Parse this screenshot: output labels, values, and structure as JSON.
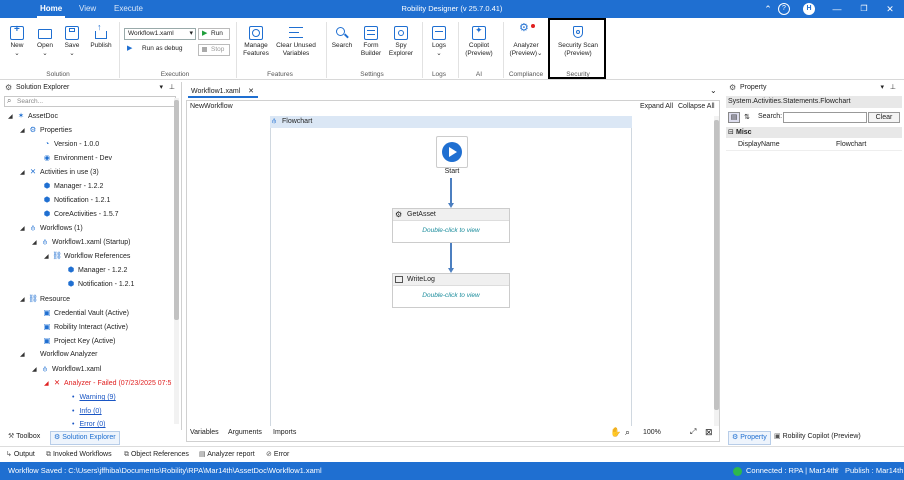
{
  "titlebar": {
    "tabs": [
      "Home",
      "View",
      "Execute"
    ],
    "app_title": "Robility Designer (v 25.7.0.41)",
    "help_label": "?",
    "avatar_initial": "H",
    "accent": "#1f6fd1"
  },
  "ribbon": {
    "new": "New",
    "open": "Open",
    "save": "Save",
    "publish": "Publish",
    "group_solution": "Solution",
    "workflow_select": "Workflow1.xaml",
    "run": "Run",
    "run_debug": "Run as debug",
    "stop": "Stop",
    "group_execution": "Execution",
    "manage_features": [
      "Manage",
      "Features"
    ],
    "clear_unused": [
      "Clear Unused",
      "Variables"
    ],
    "group_features": "Features",
    "search": "Search",
    "form_builder": [
      "Form",
      "Builder"
    ],
    "spy_explorer": [
      "Spy",
      "Explorer"
    ],
    "group_settings": "Settings",
    "logs": "Logs",
    "group_logs": "Logs",
    "copilot": [
      "Copilot",
      "(Preview)"
    ],
    "group_ai": "AI",
    "analyzer": [
      "Analyzer",
      "(Preview)"
    ],
    "group_compliance": "Compliance",
    "security_scan": [
      "Security Scan",
      "(Preview)"
    ],
    "group_security": "Security"
  },
  "solution_explorer": {
    "title": "Solution Explorer",
    "search_placeholder": "Search...",
    "items": [
      {
        "label": "AssetDoc",
        "level": 0
      },
      {
        "label": "Properties",
        "level": 1
      },
      {
        "label": "Version - 1.0.0",
        "level": 2
      },
      {
        "label": "Environment - Dev",
        "level": 2
      },
      {
        "label": "Activities in use (3)",
        "level": 1
      },
      {
        "label": "Manager - 1.2.2",
        "level": 2
      },
      {
        "label": "Notification - 1.2.1",
        "level": 2
      },
      {
        "label": "CoreActivities - 1.5.7",
        "level": 2
      },
      {
        "label": "Workflows (1)",
        "level": 1
      },
      {
        "label": "Workflow1.xaml (Startup)",
        "level": 2
      },
      {
        "label": "Workflow References",
        "level": 3
      },
      {
        "label": "Manager - 1.2.2",
        "level": 4
      },
      {
        "label": "Notification - 1.2.1",
        "level": 4
      },
      {
        "label": "Resource",
        "level": 1
      },
      {
        "label": "Credential Vault (Active)",
        "level": 2
      },
      {
        "label": "Robility Interact (Active)",
        "level": 2
      },
      {
        "label": "Project Key (Active)",
        "level": 2
      },
      {
        "label": "Workflow Analyzer",
        "level": 1
      },
      {
        "label": "Workflow1.xaml",
        "level": 2
      },
      {
        "label": "Analyzer - Failed (07/23/2025 07:5",
        "level": 3
      },
      {
        "label": "Warning (9)",
        "level": 4
      },
      {
        "label": "Info (0)",
        "level": 4
      },
      {
        "label": "Error (0)",
        "level": 4
      }
    ],
    "bottom_tabs": [
      "Toolbox",
      "Solution Explorer"
    ]
  },
  "designer": {
    "doc_tab": "Workflow1.xaml",
    "breadcrumb": "NewWorkflow",
    "expand_all": "Expand All",
    "collapse_all": "Collapse All",
    "flowchart_title": "Flowchart",
    "start_label": "Start",
    "activities": [
      {
        "title": "GetAsset",
        "hint": "Double-click to view"
      },
      {
        "title": "WriteLog",
        "hint": "Double-click to view"
      }
    ],
    "bottom_tabs": [
      "Variables",
      "Arguments",
      "Imports"
    ],
    "zoom": "100%"
  },
  "property_panel": {
    "title": "Property",
    "type_name": "System.Activities.Statements.Flowchart",
    "search_label": "Search:",
    "clear_label": "Clear",
    "category": "Misc",
    "rows": [
      {
        "name": "DisplayName",
        "value": "Flowchart"
      }
    ],
    "bottom_tabs": [
      "Property",
      "Robility Copilot (Preview)"
    ]
  },
  "output_tabs": [
    "Output",
    "Invoked Workflows",
    "Object References",
    "Analyzer report",
    "Error"
  ],
  "status": {
    "left": "Workflow Saved : C:\\Users\\jffhiba\\Documents\\Robility\\RPA\\Mar14th\\AssetDoc\\Workflow1.xaml",
    "connected": "Connected : RPA | Mar14th",
    "publish": "Publish : Mar14th"
  }
}
